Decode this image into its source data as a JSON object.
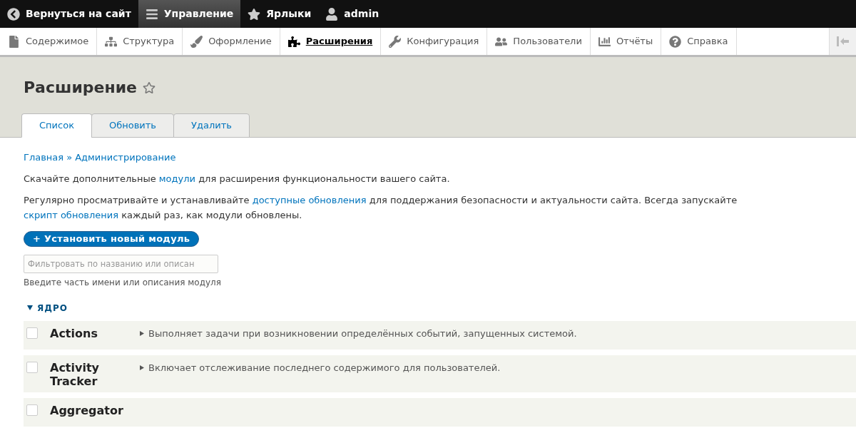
{
  "toolbar": {
    "items": [
      {
        "kind": "back",
        "label": "Вернуться на сайт",
        "selected": false
      },
      {
        "kind": "menu",
        "label": "Управление",
        "selected": true
      },
      {
        "kind": "star",
        "label": "Ярлыки",
        "selected": false
      },
      {
        "kind": "user",
        "label": "admin",
        "selected": false
      }
    ]
  },
  "tray": {
    "items": [
      {
        "kind": "file",
        "label": "Содержимое",
        "selected": false
      },
      {
        "kind": "tree",
        "label": "Структура",
        "selected": false
      },
      {
        "kind": "brush",
        "label": "Оформление",
        "selected": false
      },
      {
        "kind": "puzzle",
        "label": "Расширения",
        "selected": true
      },
      {
        "kind": "wrench",
        "label": "Конфигурация",
        "selected": false
      },
      {
        "kind": "people",
        "label": "Пользователи",
        "selected": false
      },
      {
        "kind": "bars",
        "label": "Отчёты",
        "selected": false
      },
      {
        "kind": "help",
        "label": "Справка",
        "selected": false
      }
    ]
  },
  "page": {
    "title": "Расширение",
    "favorite": false
  },
  "tabs": [
    {
      "label": "Список",
      "selected": true
    },
    {
      "label": "Обновить",
      "selected": false
    },
    {
      "label": "Удалить",
      "selected": false
    }
  ],
  "breadcrumb": [
    "Главная",
    "Администрирование"
  ],
  "breadcrumb_separator": "»",
  "paragraphs": [
    [
      {
        "text": "Скачайте дополнительные ",
        "link": false
      },
      {
        "text": "модули",
        "link": true
      },
      {
        "text": " для расширения функциональности вашего сайта.",
        "link": false
      }
    ],
    [
      {
        "text": "Регулярно просматривайте и устанавливайте ",
        "link": false
      },
      {
        "text": "доступные обновления",
        "link": true
      },
      {
        "text": " для поддержания безопасности и актуальности сайта. Всегда запускайте ",
        "link": false
      },
      {
        "text": "скрипт обновления",
        "link": true
      },
      {
        "text": " каждый раз, как модули обновлены.",
        "link": false
      }
    ]
  ],
  "install_button": "+ Установить новый модуль",
  "filter": {
    "placeholder": "Фильтровать по названию или описан",
    "hint": "Введите часть имени или описания модуля"
  },
  "group": {
    "title": "ЯДРО",
    "expanded": true
  },
  "modules": [
    {
      "name": "Actions",
      "description": "Выполняет задачи при возникновении определённых событий, запущенных системой.",
      "checked": false
    },
    {
      "name": "Activity Tracker",
      "description": "Включает отслеживание последнего содержимого для пользователей.",
      "checked": false
    },
    {
      "name": "Aggregator",
      "checked": false
    }
  ]
}
